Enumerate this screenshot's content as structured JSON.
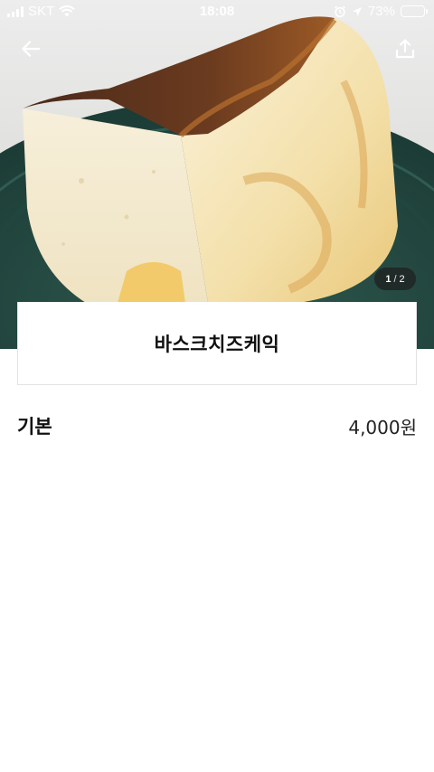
{
  "status_bar": {
    "carrier": "SKT",
    "time": "18:08",
    "battery": "73%",
    "battery_level": 0.73
  },
  "header": {
    "back_icon": "arrow-left-icon",
    "share_icon": "share-upload-icon"
  },
  "gallery": {
    "current": "1",
    "separator": "/",
    "total": "2"
  },
  "product": {
    "name": "바스크치즈케익"
  },
  "options": [
    {
      "label": "기본",
      "price": "4,000원"
    }
  ]
}
